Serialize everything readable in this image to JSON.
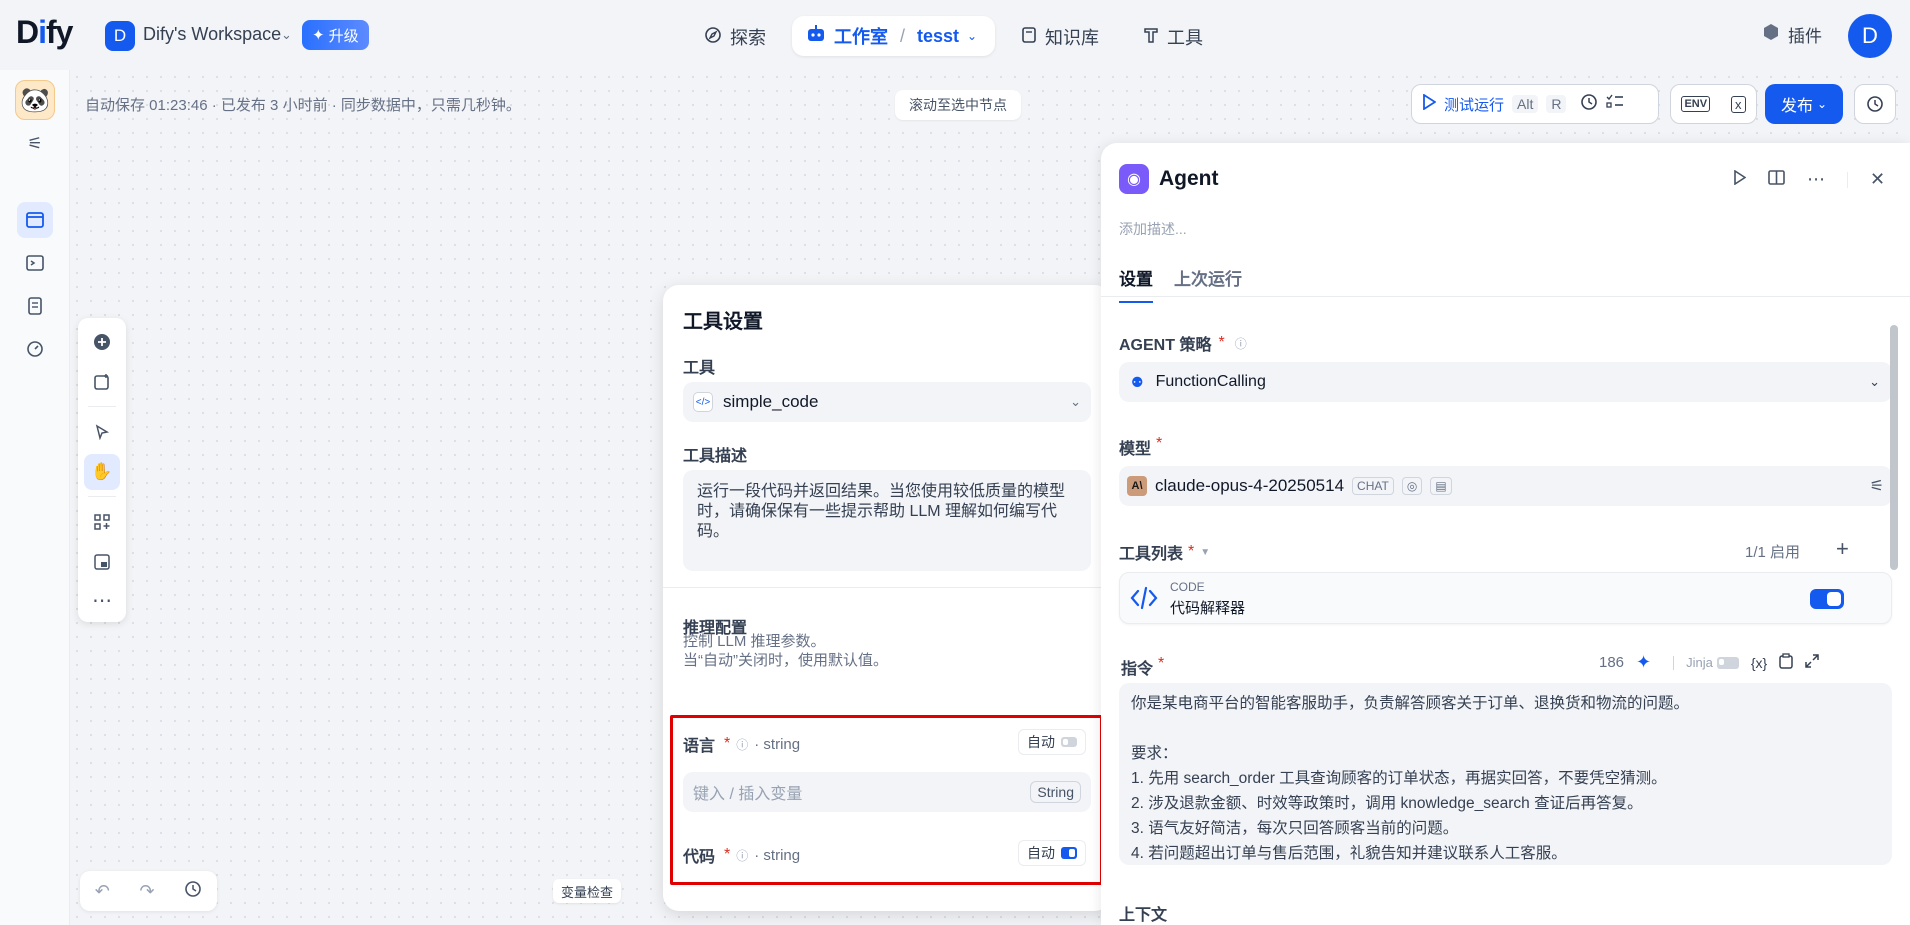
{
  "header": {
    "logo": "Dify",
    "workspace_initial": "D",
    "workspace_name": "Dify's Workspace",
    "upgrade_label": "升级",
    "nav": {
      "explore": "探索",
      "studio": "工作室",
      "app": "tesst",
      "knowledge": "知识库",
      "tools": "工具"
    },
    "plugins": "插件",
    "avatar": "D"
  },
  "toolbar": {
    "status": "自动保存 01:23:46 · 已发布 3 小时前 · 同步数据中，只需几秒钟。",
    "scroll_to_node": "滚动至选中节点",
    "test_run": "测试运行",
    "kbd_alt": "Alt",
    "kbd_r": "R",
    "env": "ENV",
    "publish": "发布"
  },
  "canvas": {
    "var_inspect": "变量检查"
  },
  "tool_settings": {
    "title": "工具设置",
    "tool_label": "工具",
    "tool_value": "simple_code",
    "desc_label": "工具描述",
    "desc_text": "运行一段代码并返回结果。当您使用较低质量的模型时，请确保保有一些提示帮助 LLM 理解如何编写代码。",
    "reasoning_label": "推理配置",
    "reasoning_sub1": "控制 LLM 推理参数。",
    "reasoning_sub2": "当“自动”关闭时，使用默认值。",
    "params": [
      {
        "name": "语言",
        "type": "· string",
        "auto_label": "自动",
        "auto_on": false
      },
      {
        "name": "代码",
        "type": "· string",
        "auto_label": "自动",
        "auto_on": true
      }
    ],
    "input_placeholder": "键入 / 插入变量",
    "input_type": "String"
  },
  "agent_panel": {
    "title": "Agent",
    "desc_placeholder": "添加描述...",
    "tabs": [
      "设置",
      "上次运行"
    ],
    "strategy_label": "AGENT 策略",
    "strategy_value": "FunctionCalling",
    "model_label": "模型",
    "model_value": "claude-opus-4-20250514",
    "model_tag": "CHAT",
    "tools_label": "工具列表",
    "tools_count": "1/1 启用",
    "tool_card": {
      "type": "CODE",
      "name": "代码解释器"
    },
    "instruction_label": "指令",
    "instruction_count": "186",
    "jinja": "Jinja",
    "var_btn": "{x}",
    "instruction_lines": [
      "你是某电商平台的智能客服助手，负责解答顾客关于订单、退换货和物流的问题。",
      "",
      "要求：",
      "1. 先用 search_order 工具查询顾客的订单状态，再据实回答，不要凭空猜测。",
      "2. 涉及退款金额、时效等政策时，调用 knowledge_search 查证后再答复。",
      "3. 语气友好简洁，每次只回答顾客当前的问题。",
      "4. 若问题超出订单与售后范围，礼貌告知并建议联系人工客服。"
    ],
    "context_label": "上下文"
  }
}
